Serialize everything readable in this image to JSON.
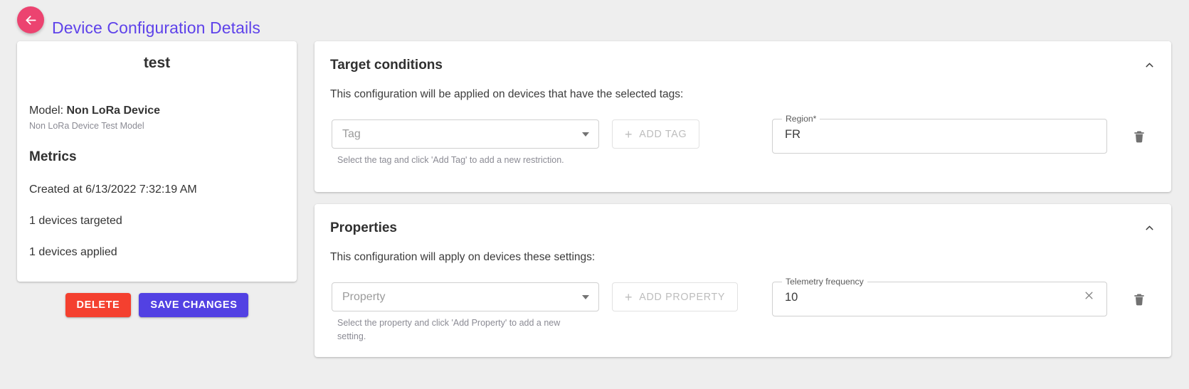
{
  "header": {
    "back_icon": "arrow-left-icon",
    "title": "Device Configuration Details",
    "accent_back": "#ec4370",
    "accent_title": "#5e42ea"
  },
  "left_card": {
    "device_name": "test",
    "model_label": "Model:",
    "model_value": "Non LoRa Device",
    "model_description": "Non LoRa Device Test Model",
    "metrics_title": "Metrics",
    "metrics": [
      "Created at 6/13/2022 7:32:19 AM",
      "1 devices targeted",
      "1 devices applied"
    ],
    "delete_label": "DELETE",
    "save_label": "SAVE CHANGES",
    "delete_color": "#f4402f",
    "save_color": "#5241e3"
  },
  "target_panel": {
    "title": "Target conditions",
    "toggle_icon": "chevron-up-icon",
    "description": "This configuration will be applied on devices that have the selected tags:",
    "select_placeholder": "Tag",
    "select_arrow_icon": "chevron-down-icon",
    "hint": "Select the tag and click 'Add Tag' to add a new restriction.",
    "add_button_label": "ADD TAG",
    "add_button_icon": "plus-icon",
    "field_label": "Region*",
    "field_value": "FR",
    "delete_icon": "trash-icon"
  },
  "properties_panel": {
    "title": "Properties",
    "toggle_icon": "chevron-up-icon",
    "description": "This configuration will apply on devices these settings:",
    "select_placeholder": "Property",
    "select_arrow_icon": "chevron-down-icon",
    "hint": "Select the property and click 'Add Property' to add a new setting.",
    "add_button_label": "ADD PROPERTY",
    "add_button_icon": "plus-icon",
    "field_label": "Telemetry frequency",
    "field_value": "10",
    "clear_icon": "close-icon",
    "delete_icon": "trash-icon"
  }
}
